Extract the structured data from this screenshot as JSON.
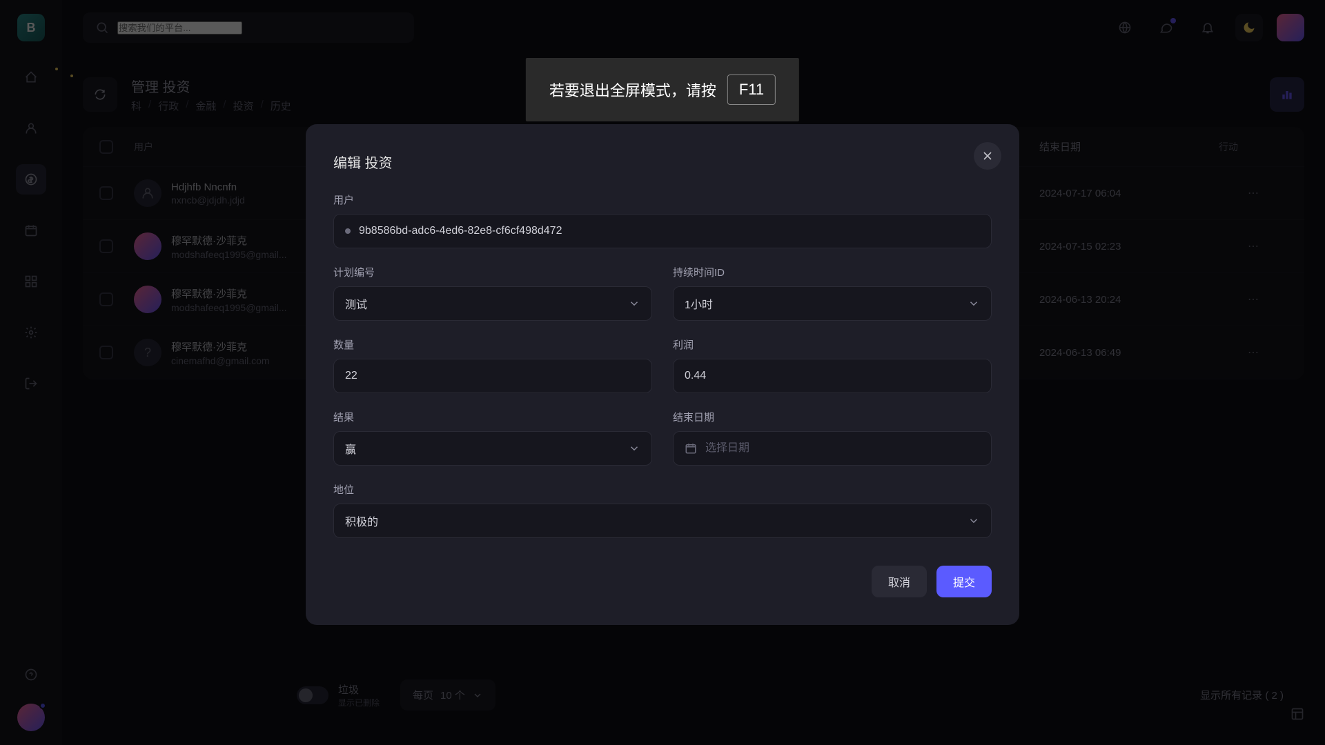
{
  "logo": "B",
  "search": {
    "placeholder": "搜索我们的平台..."
  },
  "page": {
    "title": "管理 投资",
    "breadcrumbs": [
      "科",
      "行政",
      "金融",
      "投资",
      "历史"
    ]
  },
  "table": {
    "headers": {
      "user": "用户",
      "end_date": "结束日期",
      "action": "行动"
    },
    "rows": [
      {
        "name": "Hdjhfb Nncnfn",
        "email": "nxncb@jdjdh.jdjd",
        "date": "2024-07-17 06:04",
        "avatar_type": "default"
      },
      {
        "name": "穆罕默德·沙菲克",
        "email": "modshafeeq1995@gmail...",
        "date": "2024-07-15 02:23",
        "avatar_type": "img"
      },
      {
        "name": "穆罕默德·沙菲克",
        "email": "modshafeeq1995@gmail...",
        "date": "2024-06-13 20:24",
        "avatar_type": "img"
      },
      {
        "name": "穆罕默德·沙菲克",
        "email": "cinemafhd@gmail.com",
        "date": "2024-06-13 06:49",
        "avatar_type": "question"
      }
    ]
  },
  "footer": {
    "trash_label": "垃圾",
    "trash_sub": "显示已删除",
    "per_page_prefix": "每页 ",
    "per_page_value": "10 个",
    "records_text": "显示所有记录 ( 2 )"
  },
  "fullscreen_hint": {
    "text": "若要退出全屏模式，请按 ",
    "key": "F11"
  },
  "modal": {
    "title": "编辑 投资",
    "labels": {
      "user": "用户",
      "plan_id": "计划编号",
      "duration_id": "持续时间ID",
      "amount": "数量",
      "profit": "利润",
      "result": "结果",
      "end_date": "结束日期",
      "status": "地位"
    },
    "values": {
      "user": "9b8586bd-adc6-4ed6-82e8-cf6cf498d472",
      "plan_id": "测试",
      "duration_id": "1小时",
      "amount": "22",
      "profit": "0.44",
      "result": "赢",
      "end_date_placeholder": "选择日期",
      "status": "积极的"
    },
    "actions": {
      "cancel": "取消",
      "submit": "提交"
    }
  }
}
